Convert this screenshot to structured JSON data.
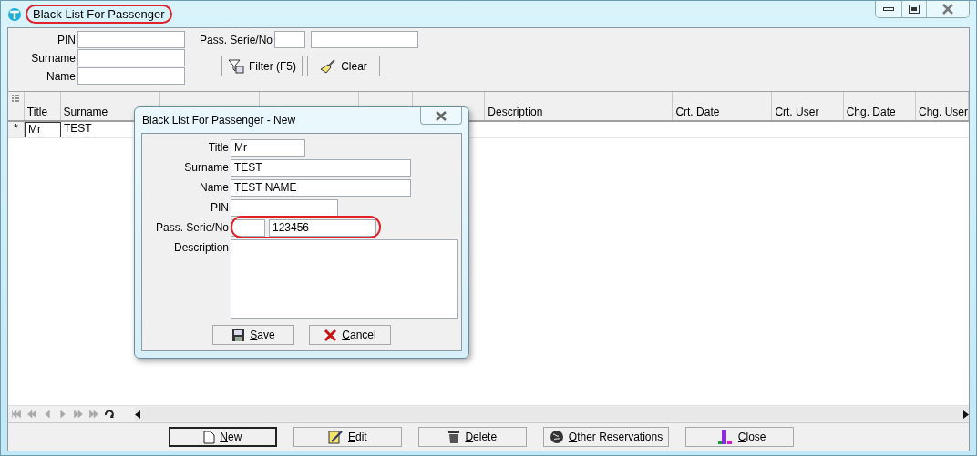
{
  "window": {
    "title": "Black List For Passenger",
    "highlighted": true
  },
  "filter": {
    "fields": [
      {
        "label": "PIN"
      },
      {
        "label": "Surname"
      },
      {
        "label": "Name"
      }
    ],
    "pass_label": "Pass. Serie/No",
    "buttons": [
      {
        "label": "Filter (F5)",
        "kind": "filter"
      },
      {
        "label": "Clear",
        "kind": "clear"
      }
    ]
  },
  "grid": {
    "columns": [
      {
        "label": "Title"
      },
      {
        "label": "Surname"
      },
      {
        "covered": true
      },
      {
        "covered": true
      },
      {
        "covered": true
      },
      {
        "covered": true
      },
      {
        "label": "Description"
      },
      {
        "label": "Crt. Date"
      },
      {
        "label": "Crt. User"
      },
      {
        "label": "Chg. Date"
      },
      {
        "label": "Chg. User"
      }
    ],
    "rows": [
      {
        "marker": "*",
        "cells": [
          {
            "text": "Mr",
            "selected": true
          },
          {
            "text": "TEST",
            "selected": false
          }
        ]
      }
    ]
  },
  "dialog": {
    "title": "Black List For Passenger - New",
    "fields": [
      {
        "label": "Title",
        "kind": "short",
        "value": "Mr"
      },
      {
        "label": "Surname",
        "kind": "long",
        "value": "TEST"
      },
      {
        "label": "Name",
        "kind": "long",
        "value": "TEST NAME"
      },
      {
        "label": "PIN",
        "kind": "medium"
      },
      {
        "label": "Pass. Serie/No",
        "kind": "pair",
        "value": "123456",
        "highlighted": true
      },
      {
        "label": "Description",
        "kind": "area"
      }
    ],
    "buttons": [
      {
        "label": "Save",
        "kind": "save"
      },
      {
        "label": "Cancel",
        "kind": "cancel"
      }
    ]
  },
  "actions": [
    {
      "label": "New",
      "kind": "new",
      "default": true
    },
    {
      "label": "Edit",
      "kind": "edit",
      "default": false
    },
    {
      "label": "Delete",
      "kind": "delete",
      "default": false
    },
    {
      "label": "Other Reservations",
      "kind": "other",
      "default": false
    },
    {
      "label": "Close",
      "kind": "close",
      "default": false
    }
  ]
}
